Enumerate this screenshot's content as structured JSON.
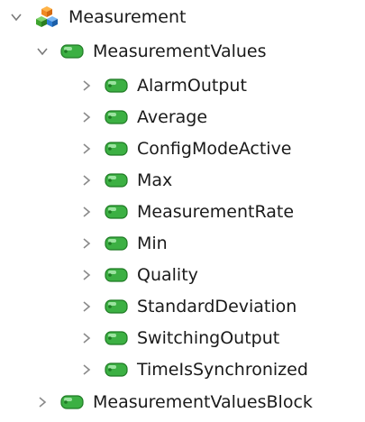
{
  "tree": {
    "root": {
      "label": "Measurement",
      "expanded": true,
      "icon": "cubes-icon"
    },
    "group": {
      "label": "MeasurementValues",
      "expanded": true,
      "icon": "green-tag-icon",
      "children": [
        {
          "label": "AlarmOutput",
          "expanded": false,
          "icon": "green-tag-icon"
        },
        {
          "label": "Average",
          "expanded": false,
          "icon": "green-tag-icon"
        },
        {
          "label": "ConfigModeActive",
          "expanded": false,
          "icon": "green-tag-icon"
        },
        {
          "label": "Max",
          "expanded": false,
          "icon": "green-tag-icon"
        },
        {
          "label": "MeasurementRate",
          "expanded": false,
          "icon": "green-tag-icon"
        },
        {
          "label": "Min",
          "expanded": false,
          "icon": "green-tag-icon"
        },
        {
          "label": "Quality",
          "expanded": false,
          "icon": "green-tag-icon"
        },
        {
          "label": "StandardDeviation",
          "expanded": false,
          "icon": "green-tag-icon"
        },
        {
          "label": "SwitchingOutput",
          "expanded": false,
          "icon": "green-tag-icon"
        },
        {
          "label": "TimeIsSynchronized",
          "expanded": false,
          "icon": "green-tag-icon"
        }
      ]
    },
    "sibling": {
      "label": "MeasurementValuesBlock",
      "expanded": false,
      "icon": "green-tag-icon"
    }
  },
  "colors": {
    "chevron": "#8a8a8a",
    "tag_fill": "#3cb043",
    "tag_dark": "#1f7a24",
    "tag_light": "#9be39f",
    "text": "#1a1a1a"
  }
}
